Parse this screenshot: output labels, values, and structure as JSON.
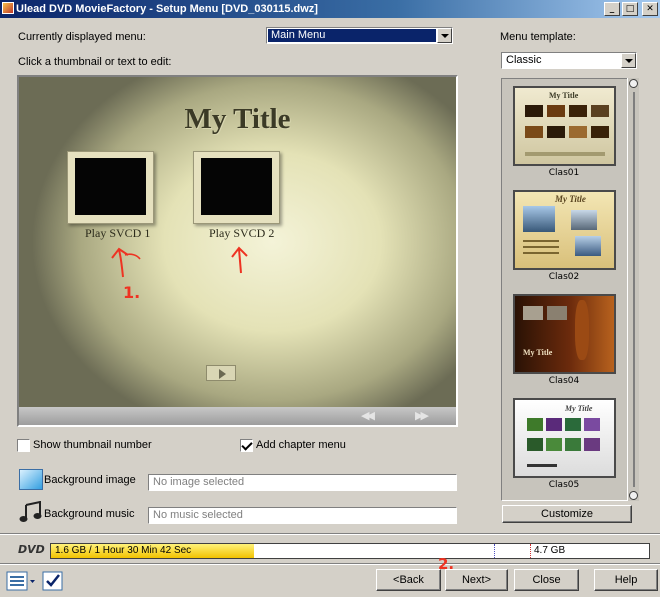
{
  "window": {
    "title": "Ulead DVD MovieFactory - Setup Menu   [DVD_030115.dwz]"
  },
  "menu_select": {
    "label": "Currently displayed menu:",
    "value": "Main Menu"
  },
  "instruction": "Click a thumbnail or text to edit:",
  "preview": {
    "title": "My Title",
    "items": [
      {
        "label": "Play SVCD 1"
      },
      {
        "label": "Play SVCD 2"
      }
    ],
    "annotation": "1."
  },
  "options": {
    "show_thumbnail_number": {
      "label": "Show thumbnail number",
      "checked": false
    },
    "add_chapter_menu": {
      "label": "Add chapter menu",
      "checked": true
    }
  },
  "background_image": {
    "label": "Background image",
    "placeholder": "No image selected"
  },
  "background_music": {
    "label": "Background music",
    "placeholder": "No music selected"
  },
  "template": {
    "label": "Menu template:",
    "value": "Classic",
    "items": [
      {
        "name": "Clas01",
        "title": "My Title"
      },
      {
        "name": "Clas02",
        "title": "My Title"
      },
      {
        "name": "Clas04",
        "title": "My Title"
      },
      {
        "name": "Clas05",
        "title": "My Title"
      }
    ],
    "customize_label": "Customize"
  },
  "status": {
    "logo": "DVD",
    "used": "1.6 GB / 1 Hour 30 Min 42 Sec",
    "capacity": "4.7 GB",
    "used_fraction": 0.34
  },
  "annotation2": "2.",
  "buttons": {
    "back": "<Back",
    "next": "Next>",
    "close": "Close",
    "help": "Help"
  },
  "colors": {
    "accent": "#0a246a",
    "annotation": "#ee3322",
    "capacity_fill": "#f2c200"
  }
}
